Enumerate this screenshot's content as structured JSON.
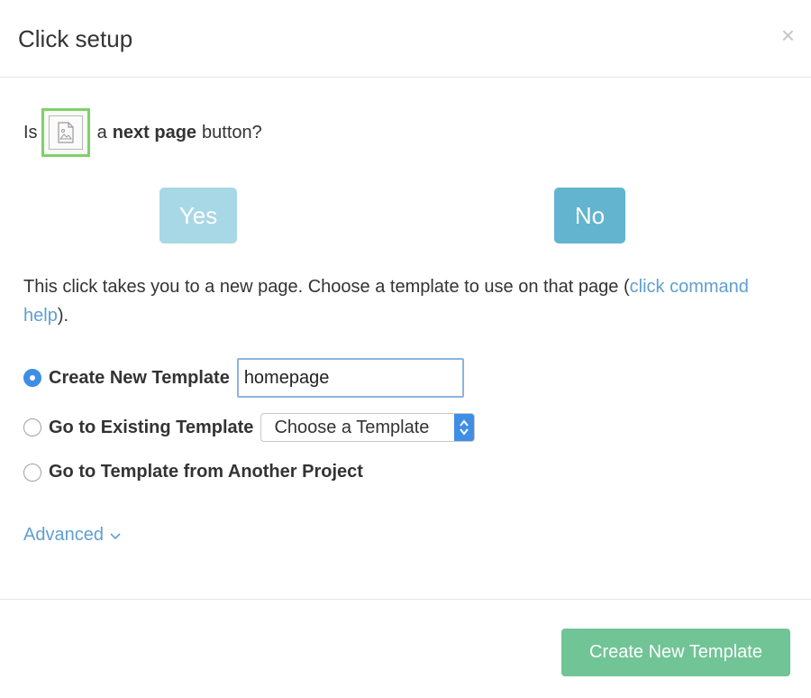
{
  "dialog": {
    "title": "Click setup",
    "close_label": "×"
  },
  "question": {
    "prefix": "Is",
    "bold": "next page",
    "middle": "a",
    "suffix": "button?"
  },
  "buttons": {
    "yes": "Yes",
    "no": "No"
  },
  "description": {
    "text": "This click takes you to a new page. Choose a template to use on that page (",
    "link": "click command help",
    "end": ")."
  },
  "options": {
    "create_new": {
      "label": "Create New Template",
      "value": "homepage",
      "selected": true
    },
    "existing": {
      "label": "Go to Existing Template",
      "select_value": "Choose a Template",
      "selected": false
    },
    "another_project": {
      "label": "Go to Template from Another Project",
      "selected": false
    }
  },
  "advanced_label": "Advanced",
  "footer": {
    "create_button": "Create New Template"
  },
  "colors": {
    "yes_button": "#a8d8e6",
    "no_button": "#62b4cf",
    "create_button": "#70c495",
    "link": "#5f9fd0",
    "radio_selected": "#3f8ee6"
  }
}
